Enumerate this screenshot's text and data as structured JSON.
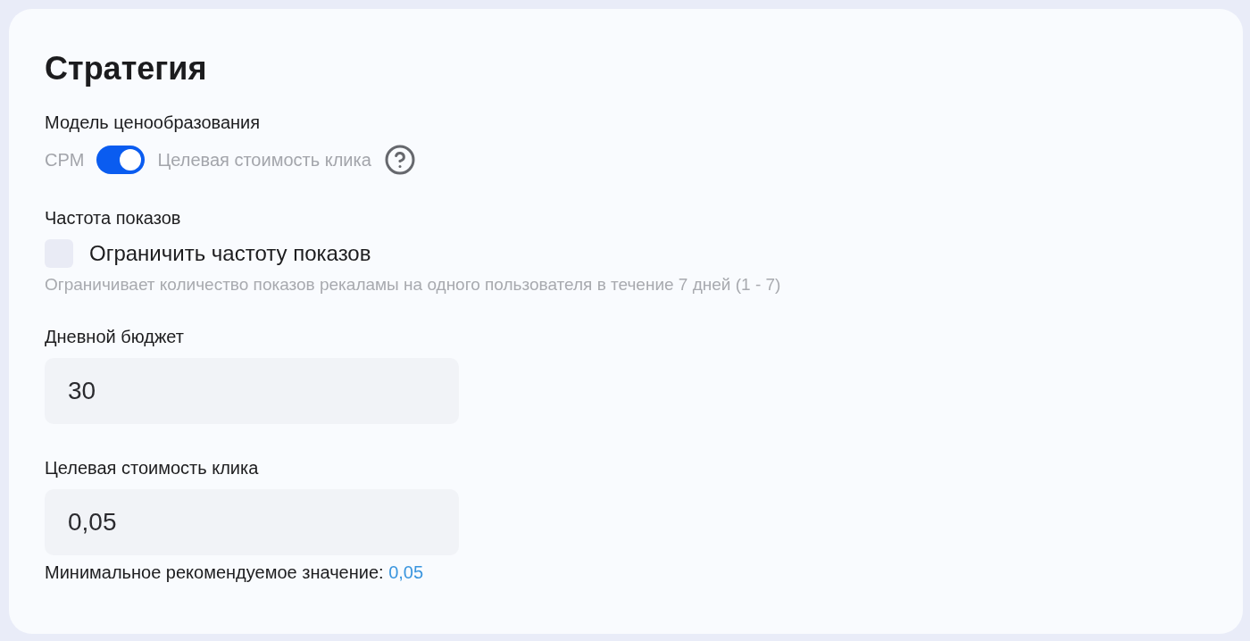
{
  "title": "Стратегия",
  "pricing": {
    "label": "Модель ценообразования",
    "left_option": "CPM",
    "right_option": "Целевая стоимость клика",
    "on": true
  },
  "frequency": {
    "label": "Частота показов",
    "checkbox_label": "Ограничить частоту показов",
    "checked": false,
    "hint": "Ограничивает количество показов рекаламы на одного пользователя в течение 7 дней (1 - 7)"
  },
  "daily_budget": {
    "label": "Дневной бюджет",
    "value": "30"
  },
  "target_cpc": {
    "label": "Целевая стоимость клика",
    "value": "0,05",
    "hint": "Минимальное рекомендуемое значение:",
    "hint_link": "0,05"
  }
}
